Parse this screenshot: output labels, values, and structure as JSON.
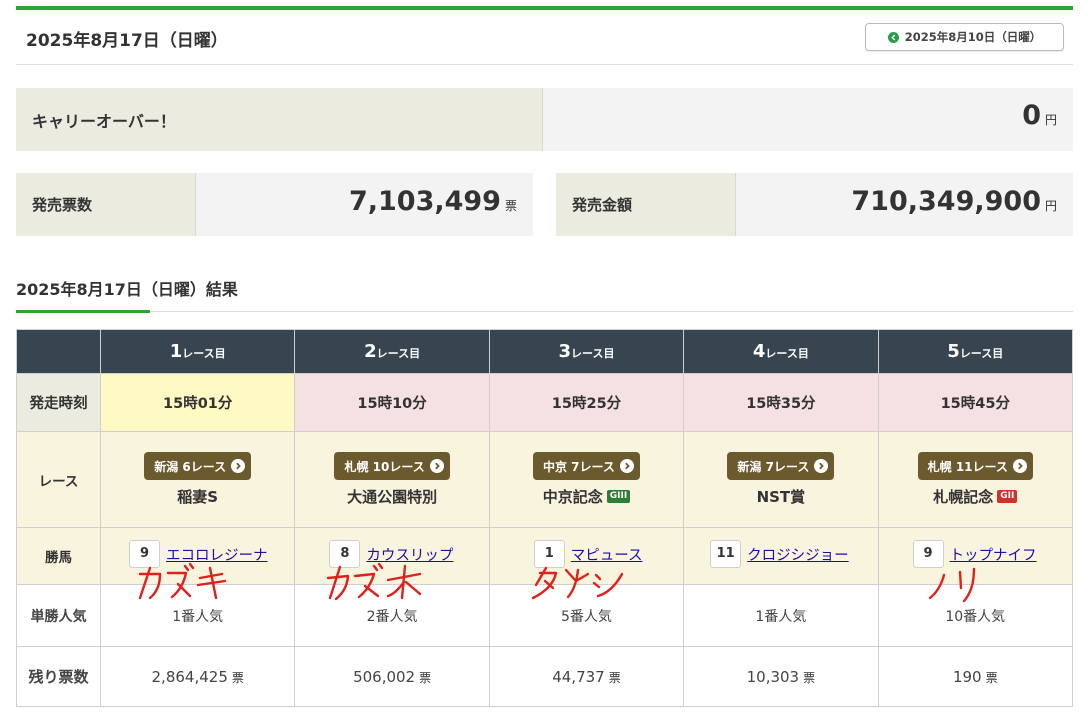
{
  "header": {
    "title": "2025年8月17日（日曜）",
    "prev_label": "2025年8月10日（日曜）"
  },
  "carryover": {
    "label": "キャリーオーバー！",
    "value": "0",
    "unit": "円"
  },
  "tickets": {
    "label": "発売票数",
    "value": "7,103,499",
    "unit": "票"
  },
  "amount": {
    "label": "発売金額",
    "value": "710,349,900",
    "unit": "円"
  },
  "results": {
    "title": "2025年8月17日（日曜）結果",
    "row_labels": {
      "time": "発走時刻",
      "race": "レース",
      "winner": "勝馬",
      "popularity": "単勝人気",
      "remaining": "残り票数"
    },
    "races": [
      {
        "num": "1",
        "suffix": "レース目",
        "time": "15時01分",
        "venue": "新潟 6レース",
        "name": "稲妻S",
        "grade": "",
        "horse_no": "9",
        "horse": "エコロレジーナ",
        "popularity": "1番人気",
        "remaining": "2,864,425",
        "rem_unit": "票"
      },
      {
        "num": "2",
        "suffix": "レース目",
        "time": "15時10分",
        "venue": "札幌 10レース",
        "name": "大通公園特別",
        "grade": "",
        "horse_no": "8",
        "horse": "カウスリップ",
        "popularity": "2番人気",
        "remaining": "506,002",
        "rem_unit": "票"
      },
      {
        "num": "3",
        "suffix": "レース目",
        "time": "15時25分",
        "venue": "中京 7レース",
        "name": "中京記念",
        "grade": "GIII",
        "horse_no": "1",
        "horse": "マピュース",
        "popularity": "5番人気",
        "remaining": "44,737",
        "rem_unit": "票"
      },
      {
        "num": "4",
        "suffix": "レース目",
        "time": "15時35分",
        "venue": "新潟 7レース",
        "name": "NST賞",
        "grade": "",
        "horse_no": "11",
        "horse": "クロジシジョー",
        "popularity": "1番人気",
        "remaining": "10,303",
        "rem_unit": "票"
      },
      {
        "num": "5",
        "suffix": "レース目",
        "time": "15時45分",
        "venue": "札幌 11レース",
        "name": "札幌記念",
        "grade": "GII",
        "horse_no": "9",
        "horse": "トップナイフ",
        "popularity": "10番人気",
        "remaining": "190",
        "rem_unit": "票"
      }
    ]
  },
  "annotations": [
    "カズキ",
    "カズオ",
    "タケシ",
    "ノリ"
  ],
  "colors": {
    "accent_green": "#2aa530",
    "header_dark": "#36454f",
    "badge_brown": "#6b5a2e",
    "link_blue": "#1a0dab",
    "handwriting_red": "#e0201b"
  }
}
